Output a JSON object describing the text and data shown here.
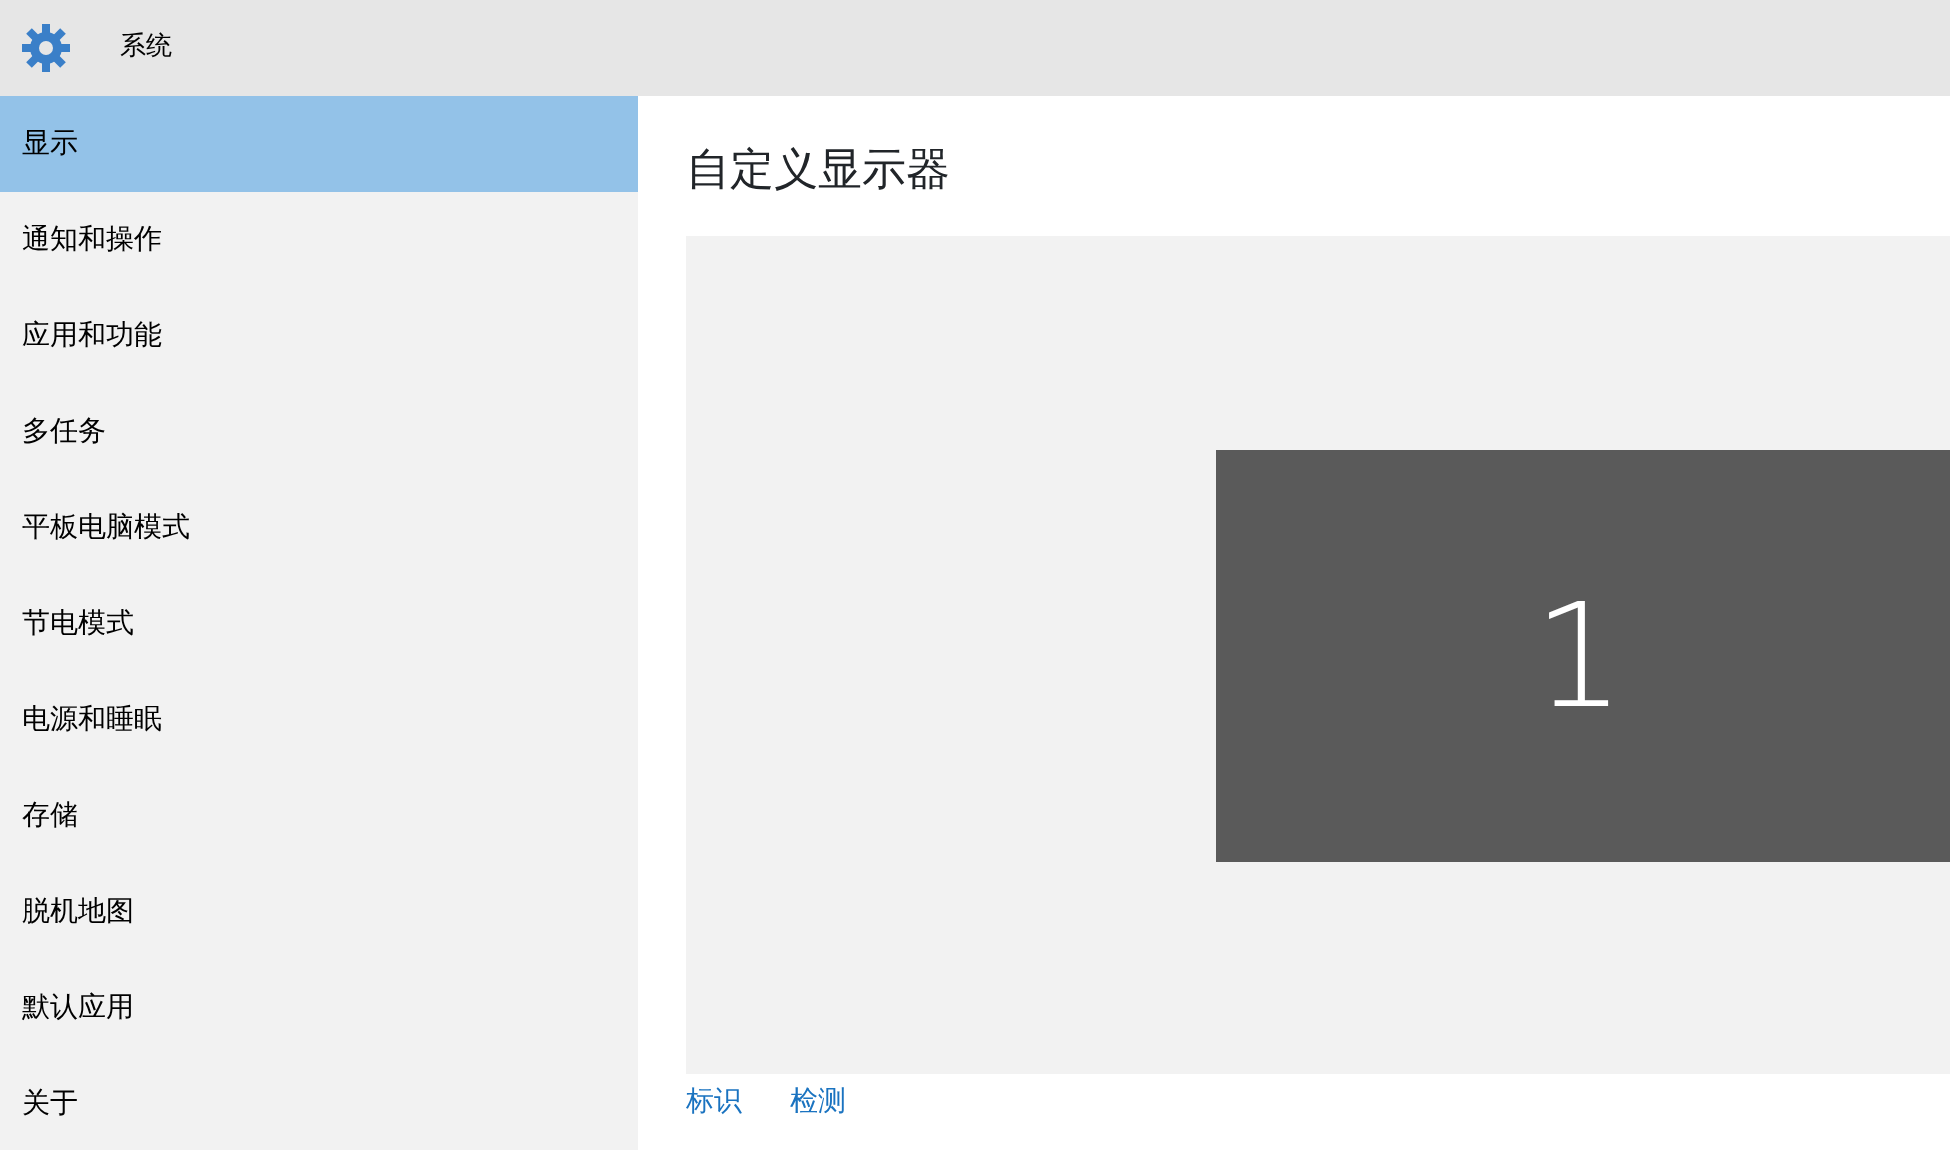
{
  "window": {
    "title": "系统"
  },
  "sidebar": {
    "items": [
      {
        "label": "显示",
        "selected": true
      },
      {
        "label": "通知和操作",
        "selected": false
      },
      {
        "label": "应用和功能",
        "selected": false
      },
      {
        "label": "多任务",
        "selected": false
      },
      {
        "label": "平板电脑模式",
        "selected": false
      },
      {
        "label": "节电模式",
        "selected": false
      },
      {
        "label": "电源和睡眠",
        "selected": false
      },
      {
        "label": "存储",
        "selected": false
      },
      {
        "label": "脱机地图",
        "selected": false
      },
      {
        "label": "默认应用",
        "selected": false
      },
      {
        "label": "关于",
        "selected": false
      }
    ]
  },
  "main": {
    "heading": "自定义显示器",
    "monitors": [
      {
        "label": "1"
      }
    ],
    "links": [
      "标识",
      "检测"
    ]
  }
}
